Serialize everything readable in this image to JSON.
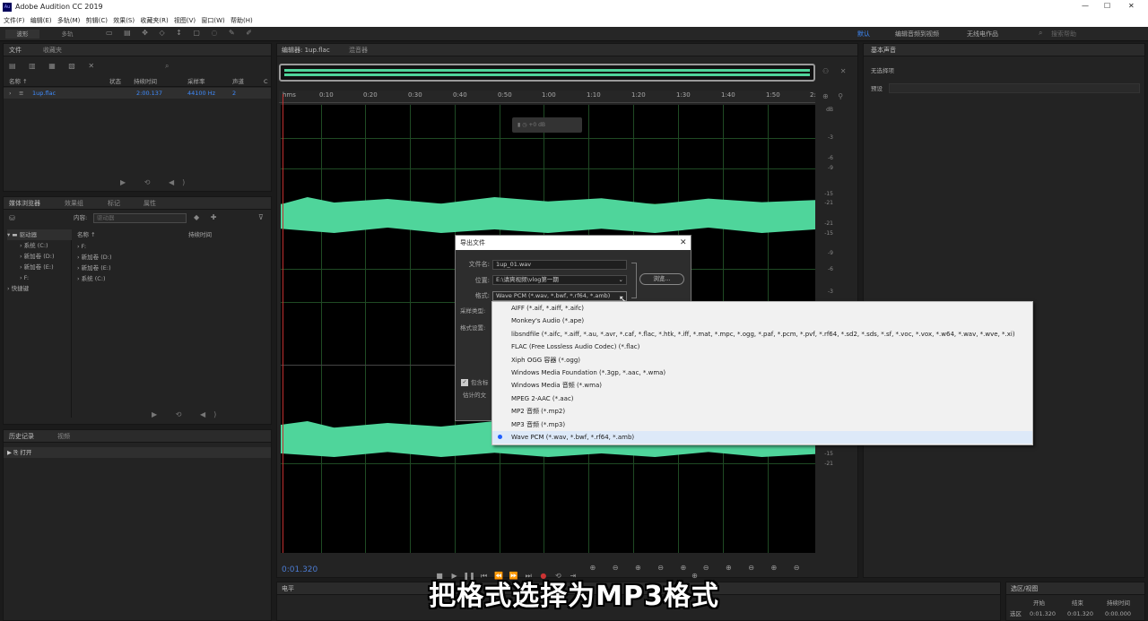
{
  "app": {
    "title": "Adobe Audition CC 2019",
    "window_controls": [
      "—",
      "☐",
      "✕"
    ]
  },
  "menu": [
    "文件(F)",
    "编辑(E)",
    "多轨(M)",
    "剪辑(C)",
    "效果(S)",
    "收藏夹(R)",
    "视图(V)",
    "窗口(W)",
    "帮助(H)"
  ],
  "toolbar": {
    "view_waveform": "波形",
    "view_multitrack": "多轨",
    "workspaces": [
      "默认",
      "编辑音频到视频",
      "无线电作品"
    ],
    "search_placeholder": "搜索帮助"
  },
  "files_panel": {
    "tabs": [
      "文件",
      "收藏夹"
    ],
    "columns": [
      "名称 ↑",
      "状态",
      "持续时间",
      "采样率",
      "声道",
      "C"
    ],
    "rows": [
      {
        "name": "1up.flac",
        "duration": "2:00.137",
        "rate": "44100 Hz",
        "channels": "2"
      }
    ]
  },
  "media_browser": {
    "tabs": [
      "媒体浏览器",
      "效果组",
      "标记",
      "属性"
    ],
    "content_label": "内容:",
    "content_value": "驱动器",
    "tree": [
      "驱动器",
      "系统 (C:)",
      "新加卷 (D:)",
      "新加卷 (E:)",
      "F:",
      "快捷键"
    ],
    "list_columns": [
      "名称 ↑",
      "持续时间"
    ],
    "list": [
      "F:",
      "新加卷 (D:)",
      "新加卷 (E:)",
      "系统 (C:)"
    ]
  },
  "history_panel": {
    "tabs": [
      "历史记录",
      "视频"
    ],
    "items": [
      "打开"
    ]
  },
  "editor": {
    "tab": "编辑器: 1up.flac",
    "mixer_tab": "混音器",
    "hud_value": "+0 dB",
    "ruler_ticks": [
      "hms",
      "0:10",
      "0:20",
      "0:30",
      "0:40",
      "0:50",
      "1:00",
      "1:10",
      "1:20",
      "1:30",
      "1:40",
      "1:50",
      "2:"
    ],
    "db_scale_top": [
      "dB",
      "-3",
      "-6",
      "-9",
      "-15",
      "-21",
      "-21",
      "-15",
      "-9",
      "-6",
      "-3"
    ],
    "db_scale_bottom": [
      "-6",
      "-9",
      "-15",
      "-21"
    ],
    "time_display": "0:01.320"
  },
  "levels_panel": {
    "tab": "电平"
  },
  "right_panel": {
    "tab": "基本声音",
    "no_selection": "无选择项",
    "preset_label": "预设"
  },
  "selection_panel": {
    "tab": "选区/视图",
    "columns": [
      "开始",
      "结束",
      "持续时间"
    ],
    "row_label": "选区",
    "start": "0:01.320",
    "end": "0:01.320",
    "duration": "0:00.000"
  },
  "dialog": {
    "title": "导出文件",
    "filename_label": "文件名:",
    "filename": "1up_01.wav",
    "location_label": "位置:",
    "location": "E:\\请爽视频\\vlog第一期",
    "browse": "浏览...",
    "format_label": "格式:",
    "format_value": "Wave PCM (*.wav, *.bwf, *.rf64, *.amb)",
    "sample_type_label": "采样类型:",
    "format_settings_label": "格式设置:",
    "include_markers": "包含标",
    "estimated_size": "估计的文"
  },
  "format_options": [
    "AIFF (*.aif, *.aiff, *.aifc)",
    "Monkey's Audio (*.ape)",
    "libsndfile (*.aifc, *.aiff, *.au, *.avr, *.caf, *.flac, *.htk, *.iff, *.mat, *.mpc, *.ogg, *.paf, *.pcm, *.pvf, *.rf64, *.sd2, *.sds, *.sf, *.voc, *.vox, *.w64, *.wav, *.wve, *.xi)",
    "FLAC (Free Lossless Audio Codec) (*.flac)",
    "Xiph OGG 容器 (*.ogg)",
    "Windows Media Foundation (*.3gp, *.aac, *.wma)",
    "Windows Media 音频 (*.wma)",
    "MPEG 2-AAC (*.aac)",
    "MP2 音频 (*.mp2)",
    "MP3 音频 (*.mp3)",
    "Wave PCM (*.wav, *.bwf, *.rf64, *.amb)"
  ],
  "selected_format_index": 10,
  "subtitle": "把格式选择为MP3格式"
}
